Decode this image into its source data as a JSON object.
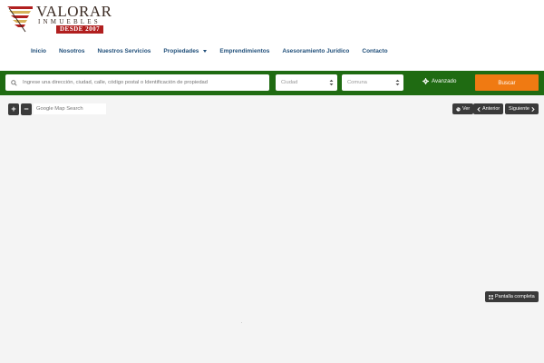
{
  "header": {
    "logo": {
      "name": "VALORAR",
      "sub": "INMUEBLES",
      "badge": "DESDE 2007"
    },
    "nav": [
      {
        "label": "Inicio"
      },
      {
        "label": "Nosotros"
      },
      {
        "label": "Nuestros Servicios"
      },
      {
        "label": "Propiedades",
        "dropdown": true
      },
      {
        "label": "Emprendimientos"
      },
      {
        "label": "Asesoramiento Jurídico"
      },
      {
        "label": "Contacto"
      }
    ]
  },
  "search": {
    "placeholder": "Ingrese una dirección, ciudad, calle, código postal o Identificación de propiedad",
    "ciudad": "Ciudad",
    "comuna": "Comuna",
    "advanced_label": "Avanzado",
    "submit_label": "Buscar",
    "icons": {
      "search": "search-icon",
      "advanced": "gear-icon"
    }
  },
  "map": {
    "zoom_in": "+",
    "zoom_out": "−",
    "search_placeholder": "Google Map Search",
    "ver_label": "Ver",
    "anterior_label": "Anterior",
    "siguiente_label": "Siguiente",
    "fullscreen_label": "Pantalla completa"
  },
  "colors": {
    "nav_text": "#1f4e79",
    "search_bar": "#1f6b12",
    "buscar_button": "#f07a12",
    "map_controls": "#3a3a3a",
    "badge": "#b11f1f"
  }
}
